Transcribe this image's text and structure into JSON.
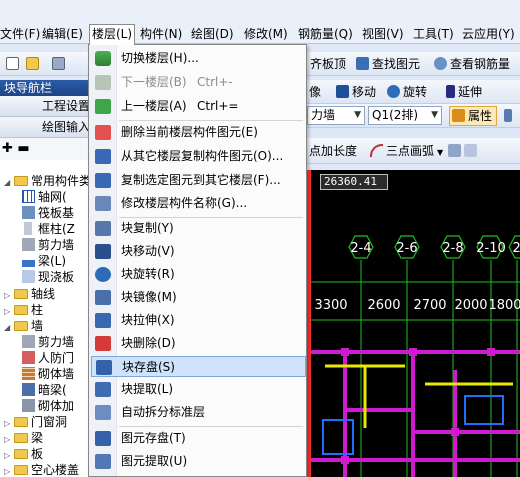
{
  "menubar": {
    "items": [
      "文件(F)",
      "编辑(E)",
      "楼层(L)",
      "构件(N)",
      "绘图(D)",
      "修改(M)",
      "钢筋量(Q)",
      "视图(V)",
      "工具(T)",
      "云应用(Y)"
    ]
  },
  "toolbar1": {
    "align_top": "齐板顶",
    "find_element": "查找图元",
    "view_rebar": "查看钢筋量"
  },
  "toolbar2": {
    "mirror": "像",
    "move": "移动",
    "rotate": "旋转",
    "extend": "延伸",
    "combo_wall": "力墙",
    "combo_q1": "Q1(2排)",
    "properties": "属性"
  },
  "toolbar3": {
    "length_point": "点加长度",
    "three_point_arc": "三点画弧"
  },
  "panel": {
    "title": "块导航栏",
    "project_settings": "工程设置",
    "drawing_input": "绘图输入",
    "tools_glyph": "✚ ▬",
    "tree": [
      "常用构件类",
      "轴网(",
      "筏板基",
      "框柱(Z",
      "剪力墙",
      "梁(L)",
      "现浇板",
      "轴线",
      "柱",
      "墙",
      "剪力墙",
      "人防门",
      "砌体墙",
      "暗梁(",
      "砌体加",
      "门窗洞",
      "梁",
      "板",
      "空心楼盖"
    ]
  },
  "cad": {
    "coordinate": "26360.41",
    "axis_labels": [
      "2-4",
      "2-6",
      "2-8",
      "2-10",
      "2-"
    ],
    "dimensions": [
      "3300",
      "2600",
      "2700",
      "2000",
      "1800"
    ]
  },
  "dropdown": {
    "items": [
      {
        "label": "切换楼层(H)...",
        "shortcut": ""
      },
      {
        "label": "下一楼层(B)",
        "shortcut": "Ctrl+-"
      },
      {
        "label": "上一楼层(A)",
        "shortcut": "Ctrl+="
      },
      {
        "label": "删除当前楼层构件图元(E)",
        "shortcut": ""
      },
      {
        "label": "从其它楼层复制构件图元(O)...",
        "shortcut": ""
      },
      {
        "label": "复制选定图元到其它楼层(F)...",
        "shortcut": ""
      },
      {
        "label": "修改楼层构件名称(G)...",
        "shortcut": ""
      },
      {
        "label": "块复制(Y)",
        "shortcut": ""
      },
      {
        "label": "块移动(V)",
        "shortcut": ""
      },
      {
        "label": "块旋转(R)",
        "shortcut": ""
      },
      {
        "label": "块镜像(M)",
        "shortcut": ""
      },
      {
        "label": "块拉伸(X)",
        "shortcut": ""
      },
      {
        "label": "块删除(D)",
        "shortcut": ""
      },
      {
        "label": "块存盘(S)",
        "shortcut": ""
      },
      {
        "label": "块提取(L)",
        "shortcut": ""
      },
      {
        "label": "自动拆分标准层",
        "shortcut": ""
      },
      {
        "label": "图元存盘(T)",
        "shortcut": ""
      },
      {
        "label": "图元提取(U)",
        "shortcut": ""
      }
    ],
    "highlighted_item": "块存盘(S)",
    "disabled_item": "下一楼层(B)"
  },
  "colors": {
    "highlight": "#cfe3fb",
    "cad_background": "#000000",
    "wall_magenta": "#d01ad0",
    "axis_green": "#1fc01f",
    "beam_yellow": "#e8e800"
  }
}
